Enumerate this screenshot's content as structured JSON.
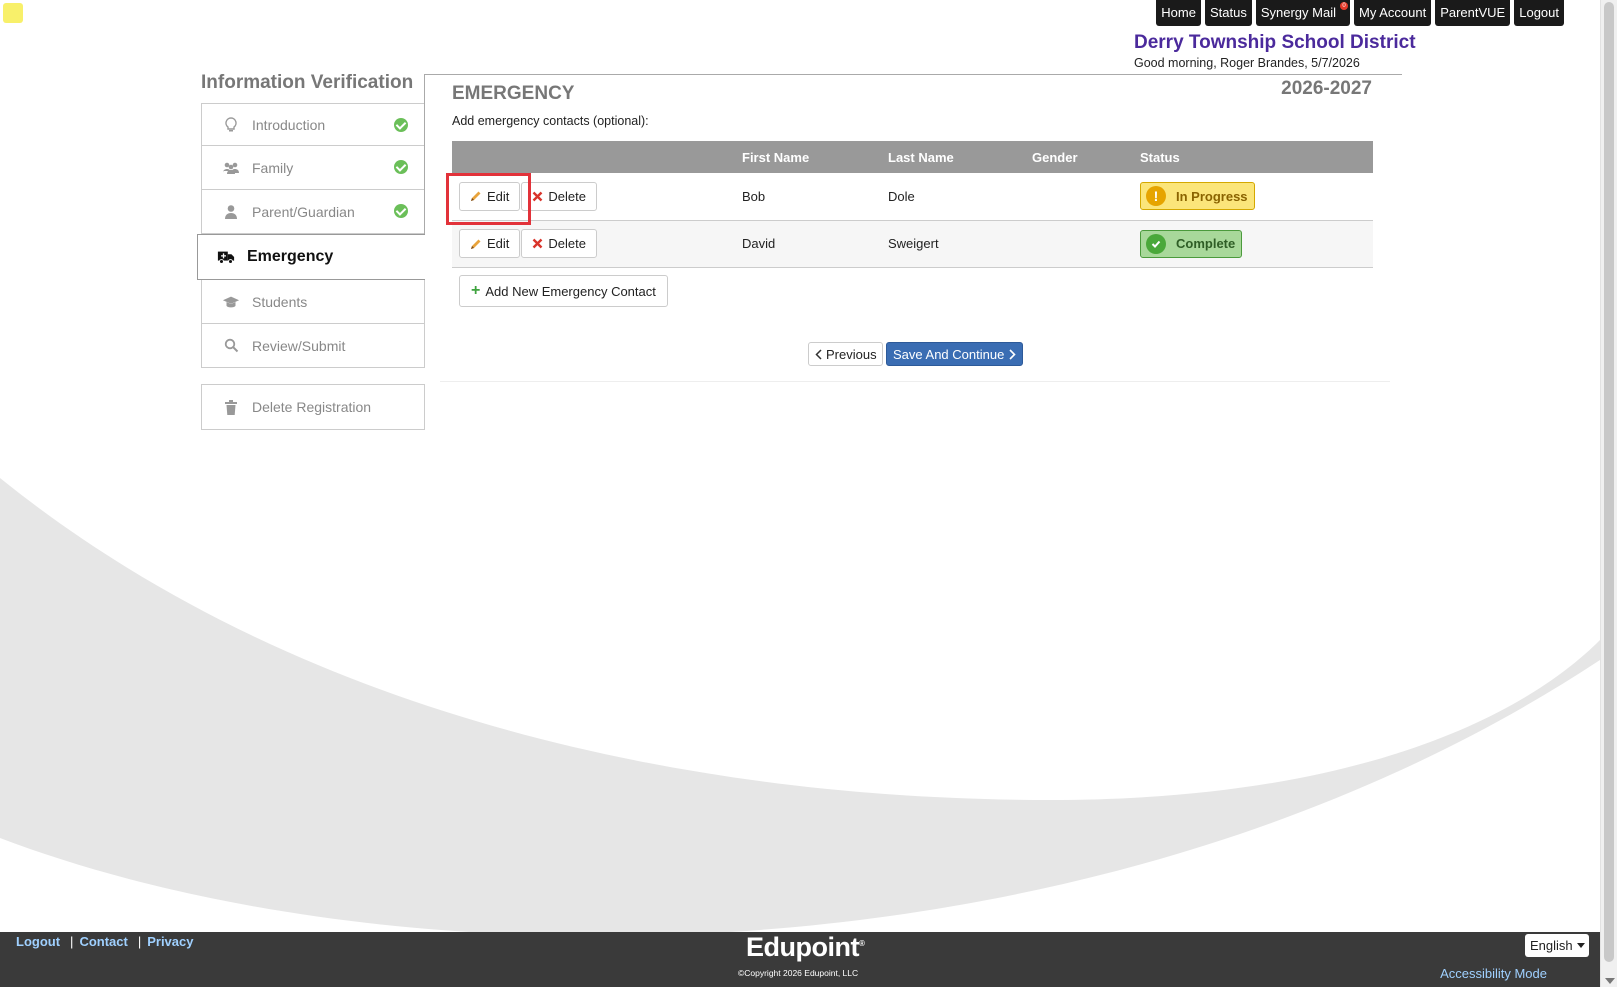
{
  "topnav": {
    "items": [
      {
        "label": "Home"
      },
      {
        "label": "Status"
      },
      {
        "label": "Synergy Mail",
        "badge": "0"
      },
      {
        "label": "My Account"
      },
      {
        "label": "ParentVUE"
      },
      {
        "label": "Logout"
      }
    ]
  },
  "header": {
    "district": "Derry Township School District",
    "greeting": "Good morning, Roger Brandes, 5/7/2026"
  },
  "sidebar": {
    "title": "Information Verification",
    "steps": [
      {
        "label": "Introduction",
        "icon": "lightbulb-icon",
        "completed": true
      },
      {
        "label": "Family",
        "icon": "users-icon",
        "completed": true
      },
      {
        "label": "Parent/Guardian",
        "icon": "user-icon",
        "completed": true
      },
      {
        "label": "Emergency",
        "icon": "ambulance-icon",
        "active": true
      },
      {
        "label": "Students",
        "icon": "graduation-cap-icon"
      },
      {
        "label": "Review/Submit",
        "icon": "search-icon"
      }
    ],
    "delete_label": "Delete Registration"
  },
  "main": {
    "section_title": "EMERGENCY",
    "year": "2026-2027",
    "hint": "Add emergency contacts (optional):",
    "columns": [
      "",
      "First Name",
      "Last Name",
      "Gender",
      "Status"
    ],
    "rows": [
      {
        "edit": "Edit",
        "delete": "Delete",
        "first_name": "Bob",
        "last_name": "Dole",
        "gender": "",
        "status": "In Progress",
        "status_type": "in-progress"
      },
      {
        "edit": "Edit",
        "delete": "Delete",
        "first_name": "David",
        "last_name": "Sweigert",
        "gender": "",
        "status": "Complete",
        "status_type": "complete"
      }
    ],
    "add_label": "Add New Emergency Contact",
    "previous_label": "Previous",
    "save_label": "Save And Continue"
  },
  "footer": {
    "links": [
      "Logout",
      "Contact",
      "Privacy"
    ],
    "brand": "Edupoint",
    "copyright": "©Copyright 2026 Edupoint, LLC",
    "language": "English",
    "accessibility": "Accessibility Mode"
  },
  "colors": {
    "district": "#4b2a9c",
    "primary_button": "#3a6db3",
    "check": "#6bbf59",
    "highlight": "#e2323a"
  }
}
